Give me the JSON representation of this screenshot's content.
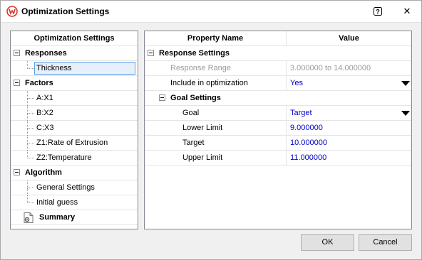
{
  "window": {
    "title": "Optimization Settings",
    "icon": "weibull-logo-icon",
    "help_glyph": "?",
    "close_glyph": "✕"
  },
  "left_panel": {
    "header": "Optimization Settings",
    "categories": [
      {
        "label": "Responses",
        "children": [
          "Thickness"
        ]
      },
      {
        "label": "Factors",
        "children": [
          "A:X1",
          "B:X2",
          "C:X3",
          "Z1:Rate of Extrusion",
          "Z2:Temperature"
        ]
      },
      {
        "label": "Algorithm",
        "children": [
          "General Settings",
          "Initial guess"
        ]
      }
    ],
    "summary": "Summary"
  },
  "grid": {
    "columns": [
      "Property Name",
      "Value"
    ],
    "response_settings": {
      "label": "Response Settings",
      "rows": [
        {
          "name": "Response Range",
          "value": "3.000000 to 14.000000"
        },
        {
          "name": "Include in optimization",
          "value": "Yes"
        }
      ]
    },
    "goal_settings": {
      "label": "Goal Settings",
      "rows": [
        {
          "name": "Goal",
          "value": "Target"
        },
        {
          "name": "Lower Limit",
          "value": "9.000000"
        },
        {
          "name": "Target",
          "value": "10.000000"
        },
        {
          "name": "Upper Limit",
          "value": "11.000000"
        }
      ]
    }
  },
  "buttons": {
    "ok": "OK",
    "cancel": "Cancel"
  },
  "colors": {
    "accent": "#d9342b",
    "value_text": "#0000c8",
    "selection_border": "#5f9ee5",
    "selection_fill": "#e5f0fb"
  }
}
